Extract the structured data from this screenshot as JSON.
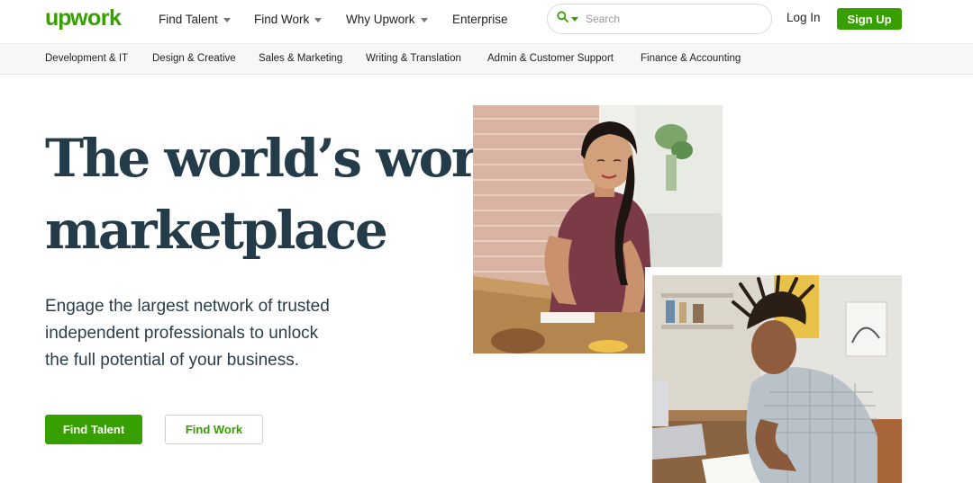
{
  "brand": {
    "name": "upwork",
    "color": "#37a000"
  },
  "nav": {
    "items": [
      {
        "label": "Find Talent",
        "has_dropdown": true
      },
      {
        "label": "Find Work",
        "has_dropdown": true
      },
      {
        "label": "Why Upwork",
        "has_dropdown": true
      },
      {
        "label": "Enterprise",
        "has_dropdown": false
      }
    ],
    "search": {
      "placeholder": "Search",
      "icon": "search-icon"
    },
    "login_label": "Log In",
    "signup_label": "Sign Up"
  },
  "categories": [
    "Development & IT",
    "Design & Creative",
    "Sales & Marketing",
    "Writing & Translation",
    "Admin & Customer Support",
    "Finance & Accounting"
  ],
  "hero": {
    "headline_line1": "The world’s work",
    "headline_line2": "marketplace",
    "sub_line1": "Engage the largest network of trusted",
    "sub_line2": "independent professionals to unlock",
    "sub_line3": "the full potential of your business.",
    "primary_button": "Find Talent",
    "secondary_button": "Find Work"
  },
  "colors": {
    "accent_green": "#37a000",
    "headline_navy": "#243b4a",
    "category_bar_bg": "#f7f7f7"
  }
}
